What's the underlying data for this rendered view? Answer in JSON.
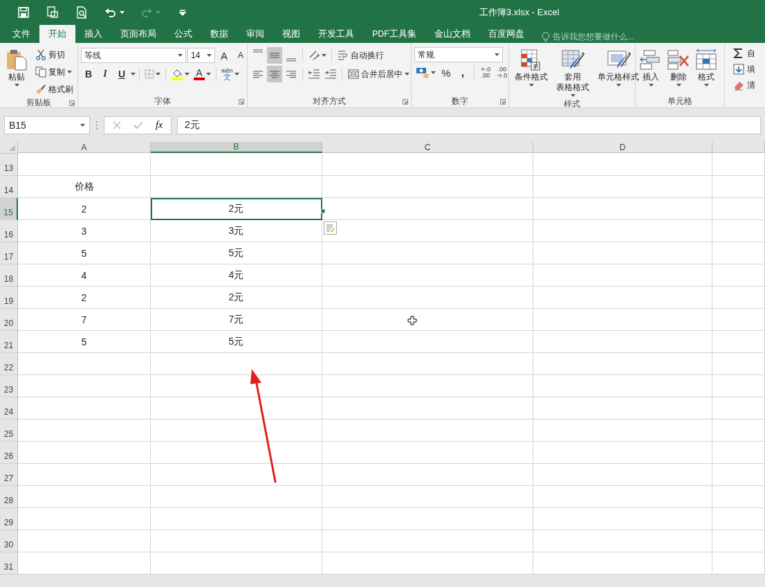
{
  "window": {
    "title": "工作簿3.xlsx - Excel"
  },
  "quick_access": [
    {
      "kind": "save",
      "disabled": false
    },
    {
      "kind": "touch",
      "disabled": false
    },
    {
      "kind": "preview",
      "disabled": false
    },
    {
      "kind": "undo",
      "disabled": false
    },
    {
      "kind": "redo",
      "disabled": true
    },
    {
      "kind": "customize",
      "disabled": false
    }
  ],
  "tabs": [
    {
      "label": "文件",
      "selected": false
    },
    {
      "label": "开始",
      "selected": true
    },
    {
      "label": "插入",
      "selected": false
    },
    {
      "label": "页面布局",
      "selected": false
    },
    {
      "label": "公式",
      "selected": false
    },
    {
      "label": "数据",
      "selected": false
    },
    {
      "label": "审阅",
      "selected": false
    },
    {
      "label": "视图",
      "selected": false
    },
    {
      "label": "开发工具",
      "selected": false
    },
    {
      "label": "PDF工具集",
      "selected": false
    },
    {
      "label": "金山文档",
      "selected": false
    },
    {
      "label": "百度网盘",
      "selected": false
    }
  ],
  "tell_me": {
    "placeholder": "告诉我您想要做什么..."
  },
  "ribbon": {
    "clipboard": {
      "label": "剪贴板",
      "dialog_launcher": true,
      "paste": "粘贴",
      "cut": "剪切",
      "copy": "复制",
      "format_painter": "格式刷"
    },
    "font": {
      "label": "字体",
      "dialog_launcher": true,
      "name": "等线",
      "size": "14",
      "grow": "A",
      "shrink": "A",
      "bold": "B",
      "italic": "I",
      "underline": "U",
      "font_color": "A",
      "phonetic_top": "wén",
      "phonetic_bottom": "文"
    },
    "alignment": {
      "label": "对齐方式",
      "dialog_launcher": true,
      "vertical": [
        {
          "kind": "top",
          "selected": false
        },
        {
          "kind": "middle",
          "selected": true
        },
        {
          "kind": "bottom",
          "selected": false
        }
      ],
      "horizontal": [
        {
          "kind": "left",
          "selected": false
        },
        {
          "kind": "center",
          "selected": true
        },
        {
          "kind": "right",
          "selected": false
        }
      ],
      "wrap": "自动换行",
      "merge": "合并后居中"
    },
    "number": {
      "label": "数字",
      "dialog_launcher": true,
      "format": "常规",
      "percent": "%",
      "comma": ",",
      "decimals": [
        {
          "kind": "increase",
          "top": ".0",
          "bottom": ".00"
        },
        {
          "kind": "decrease",
          "top": ".00",
          "bottom": ".0"
        }
      ]
    },
    "styles": {
      "label": "样式",
      "items": [
        {
          "kind": "conditional",
          "label": [
            "条件格式"
          ]
        },
        {
          "kind": "table",
          "label": [
            "套用",
            "表格格式"
          ]
        },
        {
          "kind": "cell",
          "label": [
            "单元格样式"
          ]
        }
      ]
    },
    "cells": {
      "label": "单元格",
      "items": [
        {
          "kind": "insert",
          "label": [
            "插入"
          ]
        },
        {
          "kind": "delete",
          "label": [
            "删除"
          ]
        },
        {
          "kind": "format",
          "label": [
            "格式"
          ]
        }
      ]
    },
    "editing": {
      "items": [
        {
          "kind": "sum",
          "label": "自"
        },
        {
          "kind": "fill",
          "label": "填"
        },
        {
          "kind": "clear",
          "label": "清"
        }
      ]
    }
  },
  "name_box": {
    "value": "B15"
  },
  "formula_bar": {
    "fx": "fx",
    "value": "2元"
  },
  "columns": [
    {
      "label": "A",
      "selected": false
    },
    {
      "label": "B",
      "selected": true
    },
    {
      "label": "C",
      "selected": false
    },
    {
      "label": "D",
      "selected": false
    }
  ],
  "rows": [
    {
      "header": "13",
      "selected": false
    },
    {
      "header": "14",
      "selected": false,
      "cells": [
        "价格"
      ]
    },
    {
      "header": "15",
      "selected": true,
      "cells": [
        "2",
        "2元"
      ]
    },
    {
      "header": "16",
      "selected": false,
      "cells": [
        "3",
        "3元"
      ]
    },
    {
      "header": "17",
      "selected": false,
      "cells": [
        "5",
        "5元"
      ]
    },
    {
      "header": "18",
      "selected": false,
      "cells": [
        "4",
        "4元"
      ]
    },
    {
      "header": "19",
      "selected": false,
      "cells": [
        "2",
        "2元"
      ]
    },
    {
      "header": "20",
      "selected": false,
      "cells": [
        "7",
        "7元"
      ]
    },
    {
      "header": "21",
      "selected": false,
      "cells": [
        "5",
        "5元"
      ]
    },
    {
      "header": "22",
      "selected": false
    },
    {
      "header": "23",
      "selected": false
    },
    {
      "header": "24",
      "selected": false
    },
    {
      "header": "25",
      "selected": false
    },
    {
      "header": "26",
      "selected": false
    },
    {
      "header": "27",
      "selected": false
    },
    {
      "header": "28",
      "selected": false
    },
    {
      "header": "29",
      "selected": false
    },
    {
      "header": "30",
      "selected": false
    },
    {
      "header": "31",
      "selected": false
    }
  ]
}
